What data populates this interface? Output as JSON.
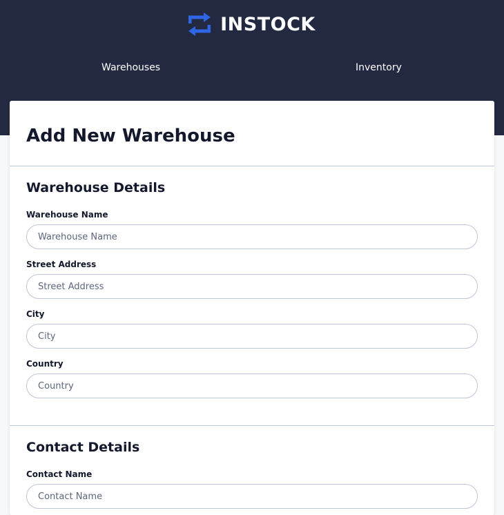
{
  "brand": {
    "name": "INSTOCK",
    "icon": "swap-arrows-icon"
  },
  "nav": [
    {
      "label": "Warehouses"
    },
    {
      "label": "Inventory"
    }
  ],
  "page": {
    "title": "Add New Warehouse"
  },
  "warehouse_details": {
    "title": "Warehouse Details",
    "fields": [
      {
        "label": "Warehouse Name",
        "placeholder": "Warehouse Name",
        "value": ""
      },
      {
        "label": "Street Address",
        "placeholder": "Street Address",
        "value": ""
      },
      {
        "label": "City",
        "placeholder": "City",
        "value": ""
      },
      {
        "label": "Country",
        "placeholder": "Country",
        "value": ""
      }
    ]
  },
  "contact_details": {
    "title": "Contact Details",
    "fields": [
      {
        "label": "Contact Name",
        "placeholder": "Contact Name",
        "value": ""
      }
    ]
  },
  "colors": {
    "header_bg": "#232940",
    "logo_blue": "#2e66e6",
    "text_dark": "#13182c",
    "border": "#bdc5d5",
    "placeholder": "#5c667e"
  }
}
